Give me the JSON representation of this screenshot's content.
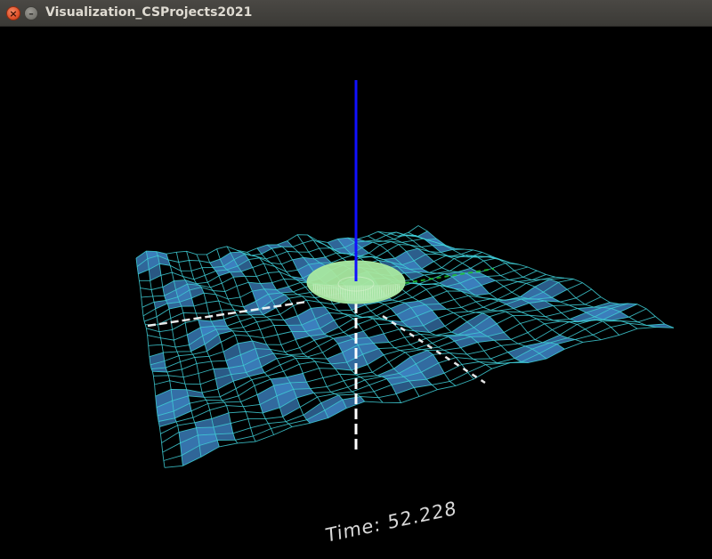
{
  "window": {
    "title": "Visualization_CSProjects2021",
    "close_glyph": "×",
    "minimize_glyph": "–"
  },
  "scene": {
    "time_text": "Time: 52.228",
    "colors": {
      "background": "#000000",
      "wave_fill": "#3f86c8",
      "wireframe": "#40d0d8",
      "vertical_axis": "#1010ff",
      "disc_fill": "#a8e8a0",
      "disc_stripes": "#d8f4d0",
      "axis_lines": "#ffffff",
      "green_axis": "#20c030",
      "time_text": "#d8d8d8"
    }
  }
}
